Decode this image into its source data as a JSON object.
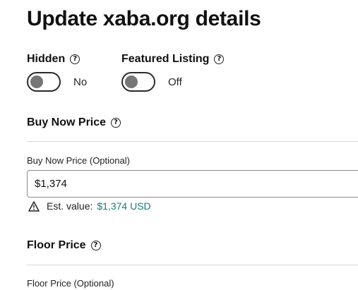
{
  "page": {
    "title": "Update xaba.org details"
  },
  "toggles": [
    {
      "label": "Hidden",
      "state": "No"
    },
    {
      "label": "Featured Listing",
      "state": "Off"
    }
  ],
  "buy_now": {
    "section_title": "Buy Now Price",
    "field_label": "Buy Now Price (Optional)",
    "value": "$1,374",
    "est_label": "Est. value:",
    "est_value": "$1,374 USD"
  },
  "floor": {
    "section_title": "Floor Price",
    "field_label": "Floor Price (Optional)"
  },
  "colors": {
    "accent_teal": "#1b7a7e",
    "knob_gray": "#767676"
  },
  "icons": {
    "help": "question-circle-icon",
    "warning": "warning-triangle-icon"
  }
}
